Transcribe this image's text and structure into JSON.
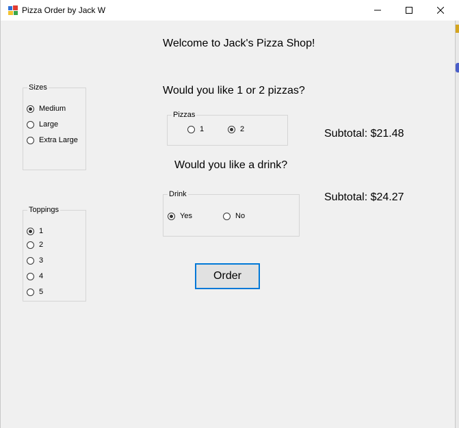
{
  "window": {
    "title": "Pizza Order by Jack W",
    "controls": {
      "minimize": "minimize",
      "maximize": "maximize",
      "close": "close"
    }
  },
  "welcome": "Welcome to Jack's Pizza Shop!",
  "sizes": {
    "title": "Sizes",
    "options": [
      {
        "label": "Medium",
        "checked": true
      },
      {
        "label": "Large",
        "checked": false
      },
      {
        "label": "Extra Large",
        "checked": false
      }
    ]
  },
  "toppings": {
    "title": "Toppings",
    "options": [
      {
        "label": "1",
        "checked": true
      },
      {
        "label": "2",
        "checked": false
      },
      {
        "label": "3",
        "checked": false
      },
      {
        "label": "4",
        "checked": false
      },
      {
        "label": "5",
        "checked": false
      }
    ]
  },
  "pizzas": {
    "question": "Would you like 1 or 2 pizzas?",
    "title": "Pizzas",
    "options": [
      {
        "label": "1",
        "checked": false
      },
      {
        "label": "2",
        "checked": true
      }
    ],
    "subtotal": "Subtotal: $21.48"
  },
  "drink": {
    "question": "Would you like a drink?",
    "title": "Drink",
    "options": [
      {
        "label": "Yes",
        "checked": true
      },
      {
        "label": "No",
        "checked": false
      }
    ],
    "subtotal": "Subtotal: $24.27"
  },
  "order_button": "Order"
}
